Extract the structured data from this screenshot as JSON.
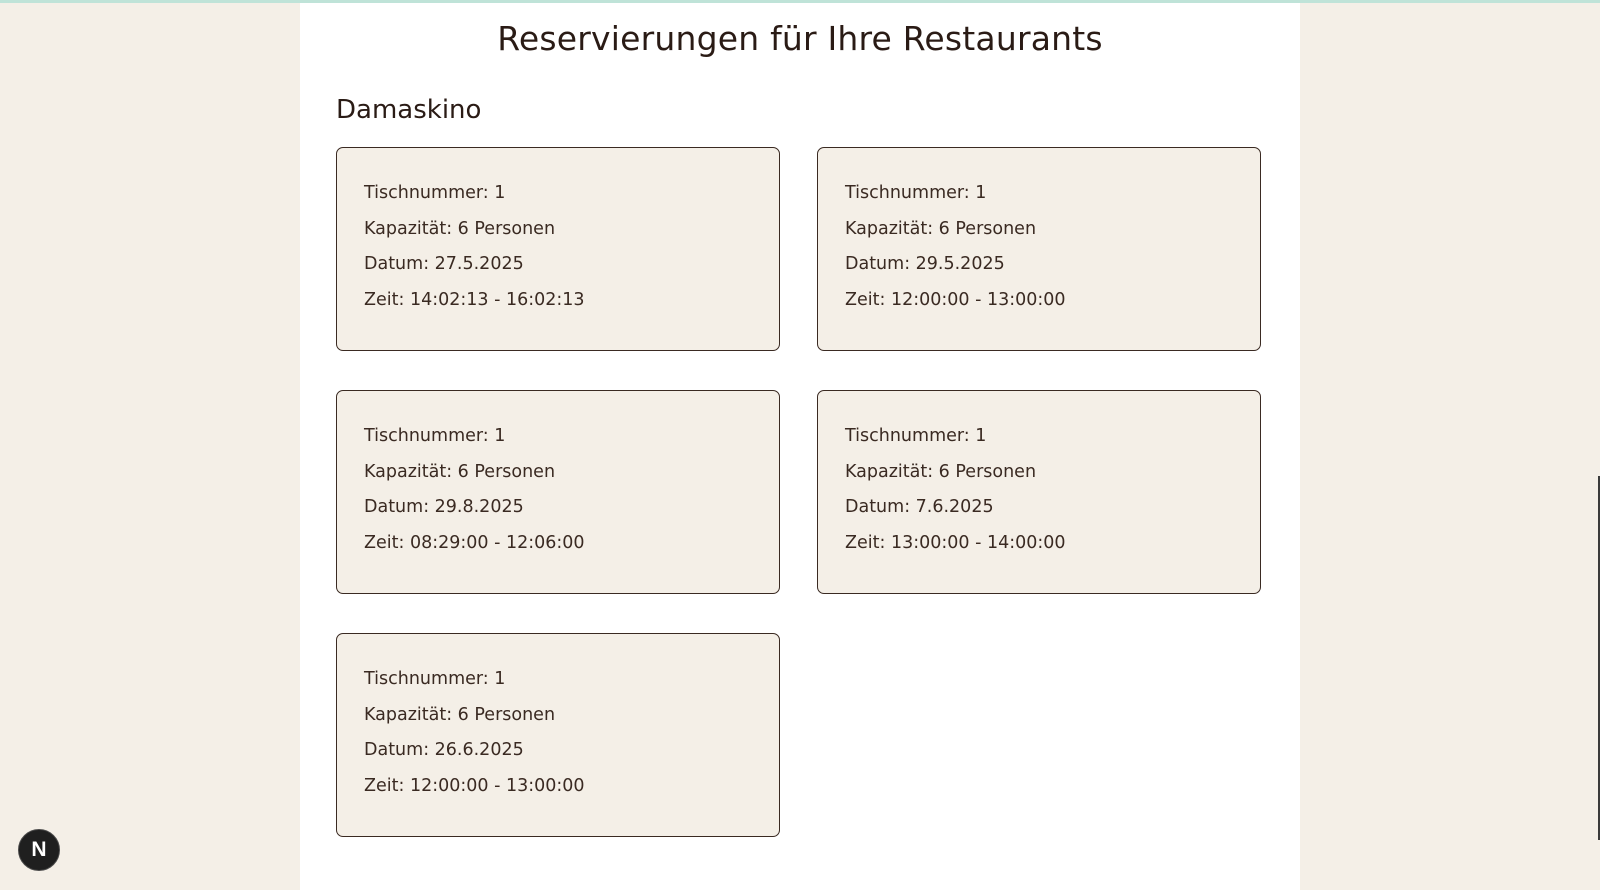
{
  "page": {
    "title": "Reservierungen für Ihre Restaurants"
  },
  "restaurant": {
    "name": "Damaskino"
  },
  "reservations": [
    {
      "table": "Tischnummer: 1",
      "capacity": "Kapazität: 6 Personen",
      "date": "Datum: 27.5.2025",
      "time": "Zeit: 14:02:13 - 16:02:13"
    },
    {
      "table": "Tischnummer: 1",
      "capacity": "Kapazität: 6 Personen",
      "date": "Datum: 29.5.2025",
      "time": "Zeit: 12:00:00 - 13:00:00"
    },
    {
      "table": "Tischnummer: 1",
      "capacity": "Kapazität: 6 Personen",
      "date": "Datum: 29.8.2025",
      "time": "Zeit: 08:29:00 - 12:06:00"
    },
    {
      "table": "Tischnummer: 1",
      "capacity": "Kapazität: 6 Personen",
      "date": "Datum: 7.6.2025",
      "time": "Zeit: 13:00:00 - 14:00:00"
    },
    {
      "table": "Tischnummer: 1",
      "capacity": "Kapazität: 6 Personen",
      "date": "Datum: 26.6.2025",
      "time": "Zeit: 12:00:00 - 13:00:00"
    }
  ],
  "dev_badge": {
    "label": "N",
    "icon": "nextjs-icon"
  },
  "colors": {
    "background": "#f4efe7",
    "panel": "#ffffff",
    "card_background": "#f4efe7",
    "text": "#3a2a22",
    "accent_top": "#bfe3d8"
  }
}
